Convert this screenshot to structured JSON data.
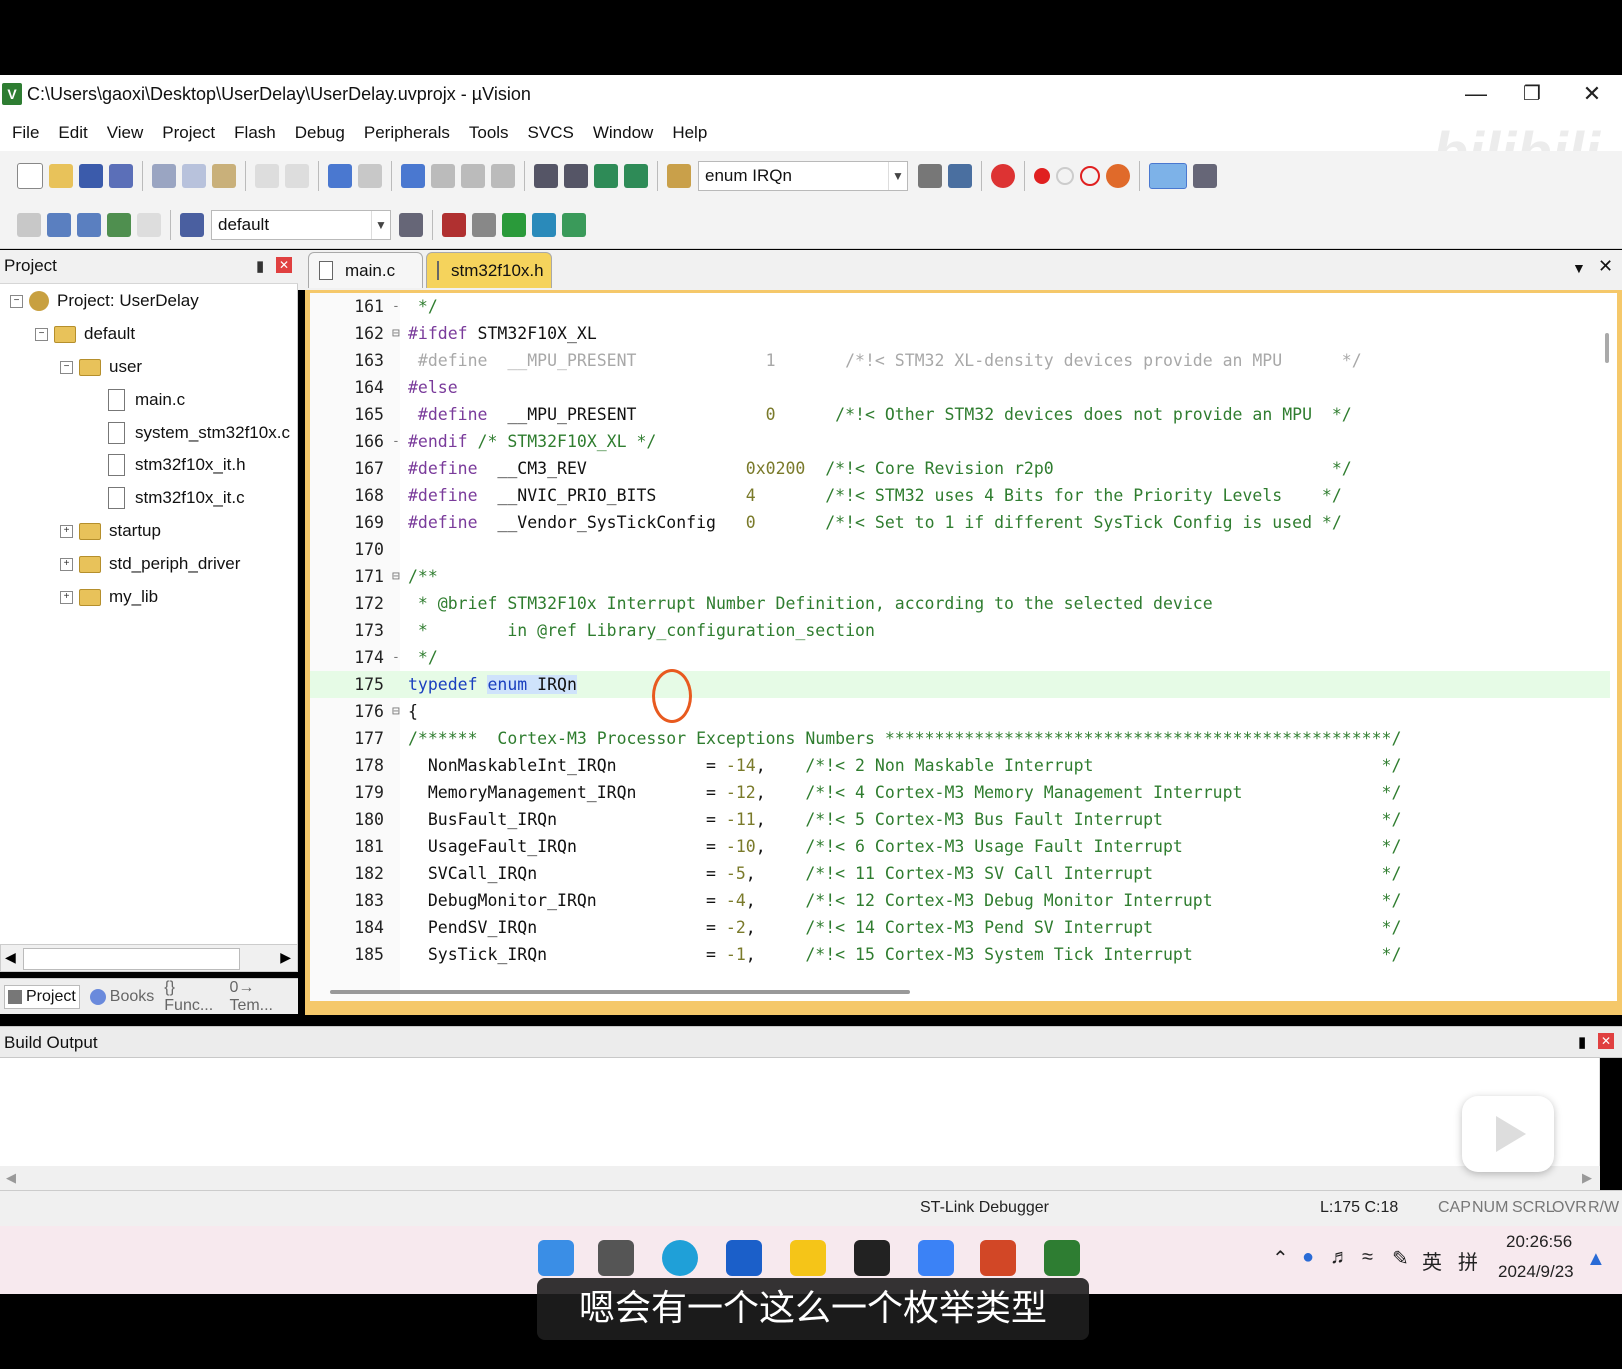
{
  "window": {
    "title": "C:\\Users\\gaoxi\\Desktop\\UserDelay\\UserDelay.uvprojx - µVision"
  },
  "menu": [
    "File",
    "Edit",
    "View",
    "Project",
    "Flash",
    "Debug",
    "Peripherals",
    "Tools",
    "SVCS",
    "Window",
    "Help"
  ],
  "toolbar": {
    "find_combo_value": "enum IRQn",
    "target_combo_value": "default"
  },
  "project_panel": {
    "title": "Project",
    "tree": {
      "project": "Project: UserDelay",
      "target": "default",
      "group_user": "user",
      "files": [
        "main.c",
        "system_stm32f10x.c",
        "stm32f10x_it.h",
        "stm32f10x_it.c"
      ],
      "groups": [
        "startup",
        "std_periph_driver",
        "my_lib"
      ]
    },
    "tabs": [
      "Project",
      "Books",
      "{} Func...",
      "0→ Tem..."
    ]
  },
  "editor": {
    "tabs": [
      "main.c",
      "stm32f10x.h"
    ],
    "active_tab": "stm32f10x.h",
    "lines": [
      {
        "n": "161",
        "fold": "-",
        "segs": [
          {
            "c": "cm",
            "t": " */"
          }
        ]
      },
      {
        "n": "162",
        "fold": "⊟",
        "segs": [
          {
            "c": "pp",
            "t": "#ifdef"
          },
          {
            "c": "tx",
            "t": " STM32F10X_XL"
          }
        ]
      },
      {
        "n": "163",
        "fold": "",
        "segs": [
          {
            "c": "dim",
            "t": " #define  __MPU_PRESENT             1       /*!< STM32 XL-density devices provide an MPU      */"
          }
        ]
      },
      {
        "n": "164",
        "fold": "",
        "segs": [
          {
            "c": "pp",
            "t": "#else"
          }
        ]
      },
      {
        "n": "165",
        "fold": "",
        "segs": [
          {
            "c": "pp",
            "t": " #define"
          },
          {
            "c": "tx",
            "t": "  __MPU_PRESENT             "
          },
          {
            "c": "nm",
            "t": "0"
          },
          {
            "c": "cm",
            "t": "      /*!< Other STM32 devices does not provide an MPU  */"
          }
        ]
      },
      {
        "n": "166",
        "fold": "-",
        "segs": [
          {
            "c": "pp",
            "t": "#endif"
          },
          {
            "c": "cm",
            "t": " /* STM32F10X_XL */"
          }
        ]
      },
      {
        "n": "167",
        "fold": "",
        "segs": [
          {
            "c": "pp",
            "t": "#define"
          },
          {
            "c": "tx",
            "t": "  __CM3_REV                "
          },
          {
            "c": "nm",
            "t": "0x0200"
          },
          {
            "c": "cm",
            "t": "  /*!< Core Revision r2p0                            */"
          }
        ]
      },
      {
        "n": "168",
        "fold": "",
        "segs": [
          {
            "c": "pp",
            "t": "#define"
          },
          {
            "c": "tx",
            "t": "  __NVIC_PRIO_BITS         "
          },
          {
            "c": "nm",
            "t": "4"
          },
          {
            "c": "cm",
            "t": "       /*!< STM32 uses 4 Bits for the Priority Levels    */"
          }
        ]
      },
      {
        "n": "169",
        "fold": "",
        "segs": [
          {
            "c": "pp",
            "t": "#define"
          },
          {
            "c": "tx",
            "t": "  __Vendor_SysTickConfig   "
          },
          {
            "c": "nm",
            "t": "0"
          },
          {
            "c": "cm",
            "t": "       /*!< Set to 1 if different SysTick Config is used */"
          }
        ]
      },
      {
        "n": "170",
        "fold": "",
        "segs": []
      },
      {
        "n": "171",
        "fold": "⊟",
        "segs": [
          {
            "c": "cm",
            "t": "/**"
          }
        ]
      },
      {
        "n": "172",
        "fold": "",
        "segs": [
          {
            "c": "cm",
            "t": " * @brief STM32F10x Interrupt Number Definition, according to the selected device"
          }
        ]
      },
      {
        "n": "173",
        "fold": "",
        "segs": [
          {
            "c": "cm",
            "t": " *        in @ref Library_configuration_section"
          }
        ]
      },
      {
        "n": "174",
        "fold": "-",
        "segs": [
          {
            "c": "cm",
            "t": " */"
          }
        ]
      },
      {
        "n": "175",
        "fold": "",
        "hl": true,
        "segs": [
          {
            "c": "kw",
            "t": "typedef"
          },
          {
            "c": "tx",
            "t": " "
          },
          {
            "c": "kw sel",
            "t": "enum"
          },
          {
            "c": "tx sel",
            "t": " IRQn"
          }
        ]
      },
      {
        "n": "176",
        "fold": "⊟",
        "segs": [
          {
            "c": "tx",
            "t": "{"
          }
        ]
      },
      {
        "n": "177",
        "fold": "",
        "segs": [
          {
            "c": "cm",
            "t": "/******  Cortex-M3 Processor Exceptions Numbers ***************************************************/"
          }
        ]
      },
      {
        "n": "178",
        "fold": "",
        "segs": [
          {
            "c": "tx",
            "t": "  NonMaskableInt_IRQn         = "
          },
          {
            "c": "nm",
            "t": "-14"
          },
          {
            "c": "tx",
            "t": ",    "
          },
          {
            "c": "cm",
            "t": "/*!< 2 Non Maskable Interrupt                             */"
          }
        ]
      },
      {
        "n": "179",
        "fold": "",
        "segs": [
          {
            "c": "tx",
            "t": "  MemoryManagement_IRQn       = "
          },
          {
            "c": "nm",
            "t": "-12"
          },
          {
            "c": "tx",
            "t": ",    "
          },
          {
            "c": "cm",
            "t": "/*!< 4 Cortex-M3 Memory Management Interrupt              */"
          }
        ]
      },
      {
        "n": "180",
        "fold": "",
        "segs": [
          {
            "c": "tx",
            "t": "  BusFault_IRQn               = "
          },
          {
            "c": "nm",
            "t": "-11"
          },
          {
            "c": "tx",
            "t": ",    "
          },
          {
            "c": "cm",
            "t": "/*!< 5 Cortex-M3 Bus Fault Interrupt                      */"
          }
        ]
      },
      {
        "n": "181",
        "fold": "",
        "segs": [
          {
            "c": "tx",
            "t": "  UsageFault_IRQn             = "
          },
          {
            "c": "nm",
            "t": "-10"
          },
          {
            "c": "tx",
            "t": ",    "
          },
          {
            "c": "cm",
            "t": "/*!< 6 Cortex-M3 Usage Fault Interrupt                    */"
          }
        ]
      },
      {
        "n": "182",
        "fold": "",
        "segs": [
          {
            "c": "tx",
            "t": "  SVCall_IRQn                 = "
          },
          {
            "c": "nm",
            "t": "-5"
          },
          {
            "c": "tx",
            "t": ",     "
          },
          {
            "c": "cm",
            "t": "/*!< 11 Cortex-M3 SV Call Interrupt                       */"
          }
        ]
      },
      {
        "n": "183",
        "fold": "",
        "segs": [
          {
            "c": "tx",
            "t": "  DebugMonitor_IRQn           = "
          },
          {
            "c": "nm",
            "t": "-4"
          },
          {
            "c": "tx",
            "t": ",     "
          },
          {
            "c": "cm",
            "t": "/*!< 12 Cortex-M3 Debug Monitor Interrupt                 */"
          }
        ]
      },
      {
        "n": "184",
        "fold": "",
        "segs": [
          {
            "c": "tx",
            "t": "  PendSV_IRQn                 = "
          },
          {
            "c": "nm",
            "t": "-2"
          },
          {
            "c": "tx",
            "t": ",     "
          },
          {
            "c": "cm",
            "t": "/*!< 14 Cortex-M3 Pend SV Interrupt                       */"
          }
        ]
      },
      {
        "n": "185",
        "fold": "",
        "segs": [
          {
            "c": "tx",
            "t": "  SysTick_IRQn                = "
          },
          {
            "c": "nm",
            "t": "-1"
          },
          {
            "c": "tx",
            "t": ",     "
          },
          {
            "c": "cm",
            "t": "/*!< 15 Cortex-M3 System Tick Interrupt                   */"
          }
        ]
      }
    ]
  },
  "build_output": {
    "title": "Build Output"
  },
  "status": {
    "debugger": "ST-Link Debugger",
    "position": "L:175 C:18",
    "flags": [
      "CAP",
      "NUM",
      "SCRL",
      "OVR",
      "R/W"
    ]
  },
  "taskbar": {
    "time": "20:26:56",
    "date": "2024/9/23",
    "ime_lang": "英",
    "ime_mode": "拼"
  },
  "subtitle": "嗯会有一个这么一个枚举类型",
  "watermark": "bilibili",
  "colors": {
    "accent_tab": "#f5d35c",
    "highlight_line": "#e6fbe6",
    "comment": "#2f7d2f",
    "keyword": "#1a3fbf",
    "preprocessor": "#7a3b9b"
  }
}
